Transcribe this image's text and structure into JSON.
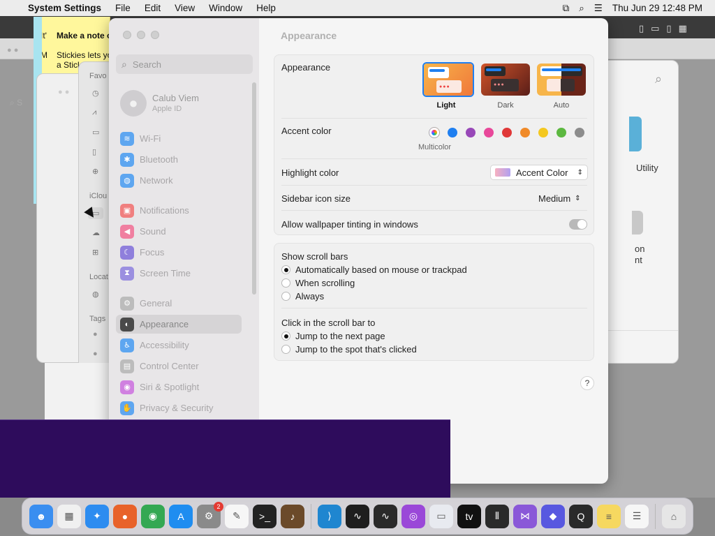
{
  "menubar": {
    "app": "System Settings",
    "items": [
      "File",
      "Edit",
      "View",
      "Window",
      "Help"
    ],
    "datetime": "Thu Jun 29  12:48 PM"
  },
  "sticky": {
    "heading": "Make a note o",
    "line1": "It'",
    "line2": "Stickies lets yo",
    "line3": "a Stick",
    "line4": "M"
  },
  "back_finder": {
    "sidebar_favorites": "Favo",
    "sidebar_icloud": "iClou",
    "sidebar_locations": "Locat",
    "sidebar_tags": "Tags",
    "search_partial": "S",
    "right_text1": "Utility",
    "right_text2": "on",
    "right_text3": "nt"
  },
  "settings": {
    "search_placeholder": "Search",
    "account": {
      "name": "Calub Viem",
      "sub": "Apple ID"
    },
    "sidebar": [
      {
        "label": "Wi-Fi",
        "color": "#5ea6f0",
        "glyph": "≋"
      },
      {
        "label": "Bluetooth",
        "color": "#5ea6f0",
        "glyph": "✱"
      },
      {
        "label": "Network",
        "color": "#5ea6f0",
        "glyph": "◍"
      },
      {
        "label": "Notifications",
        "color": "#f07f7f",
        "glyph": "▣"
      },
      {
        "label": "Sound",
        "color": "#f07fa0",
        "glyph": "◀"
      },
      {
        "label": "Focus",
        "color": "#8f7fdc",
        "glyph": "☾"
      },
      {
        "label": "Screen Time",
        "color": "#9b8fe0",
        "glyph": "⧗"
      },
      {
        "label": "General",
        "color": "#bcbcbc",
        "glyph": "⚙"
      },
      {
        "label": "Appearance",
        "color": "#4a4a4a",
        "glyph": "◐"
      },
      {
        "label": "Accessibility",
        "color": "#5ea6f0",
        "glyph": "♿"
      },
      {
        "label": "Control Center",
        "color": "#bcbcbc",
        "glyph": "▤"
      },
      {
        "label": "Siri & Spotlight",
        "color": "#d080e0",
        "glyph": "◉"
      },
      {
        "label": "Privacy & Security",
        "color": "#5ea6f0",
        "glyph": "✋"
      }
    ],
    "title": "Appearance",
    "appearance_label": "Appearance",
    "modes": [
      {
        "label": "Light"
      },
      {
        "label": "Dark"
      },
      {
        "label": "Auto"
      }
    ],
    "accent_label": "Accent color",
    "accent_colors": [
      "#e8d0f0",
      "#1f7ff0",
      "#9848b8",
      "#e8489a",
      "#e03838",
      "#f08a28",
      "#f4c820",
      "#5cb840",
      "#8c8c8c"
    ],
    "accent_selected_label": "Multicolor",
    "highlight_label": "Highlight color",
    "highlight_value": "Accent Color",
    "sidebar_icon_label": "Sidebar icon size",
    "sidebar_icon_value": "Medium",
    "wallpaper_label": "Allow wallpaper tinting in windows",
    "scrollbars_label": "Show scroll bars",
    "scrollbars_options": [
      "Automatically based on mouse or trackpad",
      "When scrolling",
      "Always"
    ],
    "click_label": "Click in the scroll bar to",
    "click_options": [
      "Jump to the next page",
      "Jump to the spot that's clicked"
    ],
    "help": "?"
  },
  "dock": {
    "apps": [
      {
        "name": "finder-icon",
        "color": "#3a8ef0",
        "glyph": "☻"
      },
      {
        "name": "launchpad-icon",
        "color": "#f0f0f0",
        "glyph": "▦"
      },
      {
        "name": "safari-icon",
        "color": "#2d8cf0",
        "glyph": "✦"
      },
      {
        "name": "firefox-icon",
        "color": "#e8622a",
        "glyph": "●"
      },
      {
        "name": "chrome-icon",
        "color": "#34a853",
        "glyph": "◉"
      },
      {
        "name": "app-store-icon",
        "color": "#1f8df0",
        "glyph": "A"
      },
      {
        "name": "system-settings-icon",
        "color": "#8a8a8a",
        "glyph": "⚙",
        "badge": "2"
      },
      {
        "name": "textedit-icon",
        "color": "#f6f6f6",
        "glyph": "✎"
      },
      {
        "name": "terminal-icon",
        "color": "#222222",
        "glyph": ">_"
      },
      {
        "name": "instruments-icon",
        "color": "#6b4a2a",
        "glyph": "♪"
      },
      {
        "name": "vscode-icon",
        "color": "#1f86d0",
        "glyph": "⟩"
      },
      {
        "name": "activity-monitor-icon",
        "color": "#1e1e1e",
        "glyph": "∿"
      },
      {
        "name": "stocks-icon",
        "color": "#2a2a2a",
        "glyph": "∿"
      },
      {
        "name": "podcasts-icon",
        "color": "#9a48d8",
        "glyph": "◎"
      },
      {
        "name": "preview-icon",
        "color": "#e8eaf0",
        "glyph": "▭"
      },
      {
        "name": "apple-tv-icon",
        "color": "#111111",
        "glyph": "tv"
      },
      {
        "name": "voice-memos-icon",
        "color": "#2a2a2a",
        "glyph": "⦀"
      },
      {
        "name": "visual-studio-icon",
        "color": "#8a58d8",
        "glyph": "⋈"
      },
      {
        "name": "shortcuts-icon",
        "color": "#5858e0",
        "glyph": "◆"
      },
      {
        "name": "quicktime-icon",
        "color": "#2a2a2a",
        "glyph": "Q"
      },
      {
        "name": "notes-icon",
        "color": "#f6d860",
        "glyph": "≡"
      },
      {
        "name": "reminders-icon",
        "color": "#f6f6f6",
        "glyph": "☰"
      },
      {
        "name": "trash-icon",
        "color": "#e6e6e6",
        "glyph": "⌂"
      }
    ]
  }
}
